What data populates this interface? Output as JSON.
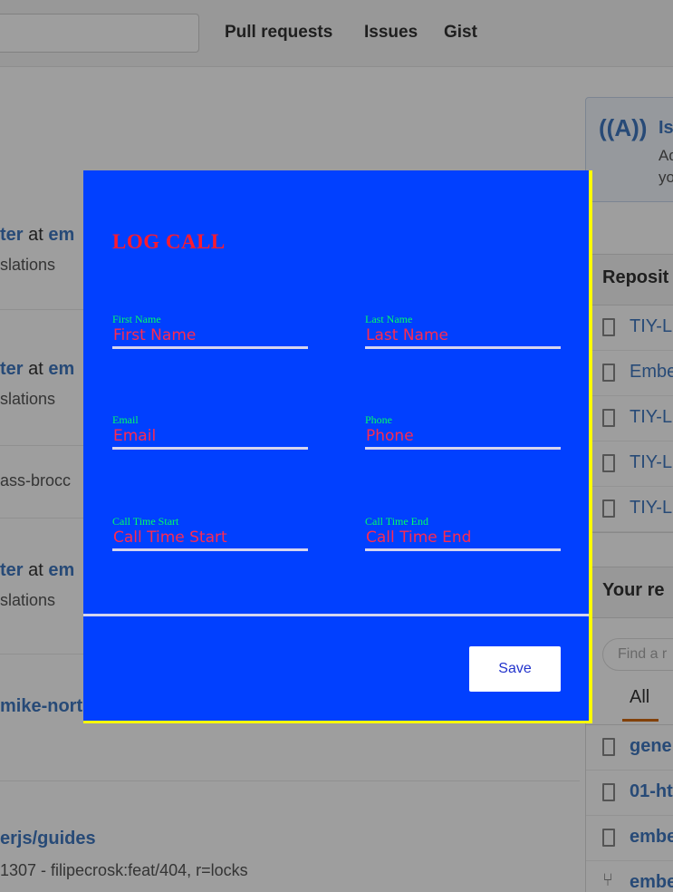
{
  "nav": {
    "links": [
      "Pull requests",
      "Issues",
      "Gist"
    ]
  },
  "feed": {
    "rows": [
      {
        "actor": "ter",
        "word": "at",
        "target": "em",
        "detail": "slations"
      },
      {
        "actor": "ter",
        "word": "at",
        "target": "em",
        "detail": "slations"
      },
      {
        "actor": "",
        "word": "",
        "target": "",
        "detail": "ass-brocc"
      },
      {
        "actor": "ter",
        "word": "at",
        "target": "em",
        "detail": "slations"
      },
      {
        "actor": "mike-nort",
        "word": "",
        "target": "",
        "detail": ""
      },
      {
        "actor": "erjs/guides",
        "word": "",
        "target": "",
        "detail": "1307 - filipecrosk:feat/404, r=locks"
      }
    ]
  },
  "sidebar": {
    "broadcast_title": "Is",
    "broadcast_line1": "Ad",
    "broadcast_line2": "yo",
    "repositories_title": "Reposit",
    "repositories": [
      "TIY-L",
      "Embe",
      "TIY-L",
      "TIY-L",
      "TIY-L"
    ],
    "your_repos_title": "Your re",
    "find_placeholder": "Find a r",
    "tab_all": "All",
    "your_repos": [
      "gene",
      "01-ht",
      "embe",
      "embe"
    ]
  },
  "modal": {
    "title": "LOG CALL",
    "fields": {
      "first_name": {
        "label": "First Name",
        "placeholder": "First Name"
      },
      "last_name": {
        "label": "Last Name",
        "placeholder": "Last Name"
      },
      "email": {
        "label": "Email",
        "placeholder": "Email"
      },
      "phone": {
        "label": "Phone",
        "placeholder": "Phone"
      },
      "call_time_start": {
        "label": "Call Time Start",
        "placeholder": "Call Time Start"
      },
      "call_time_end": {
        "label": "Call Time End",
        "placeholder": "Call Time End"
      }
    },
    "save_label": "Save"
  },
  "colors": {
    "modal_bg": "#0140ff",
    "modal_border": "#ffff00",
    "title": "#ff1a2e",
    "label": "#00ff66",
    "input_text": "#ff2a4f",
    "underline": "#d5d5ef"
  },
  "icons": {
    "broadcast": "broadcast-icon",
    "repo": "repo-icon",
    "fork": "fork-icon"
  }
}
